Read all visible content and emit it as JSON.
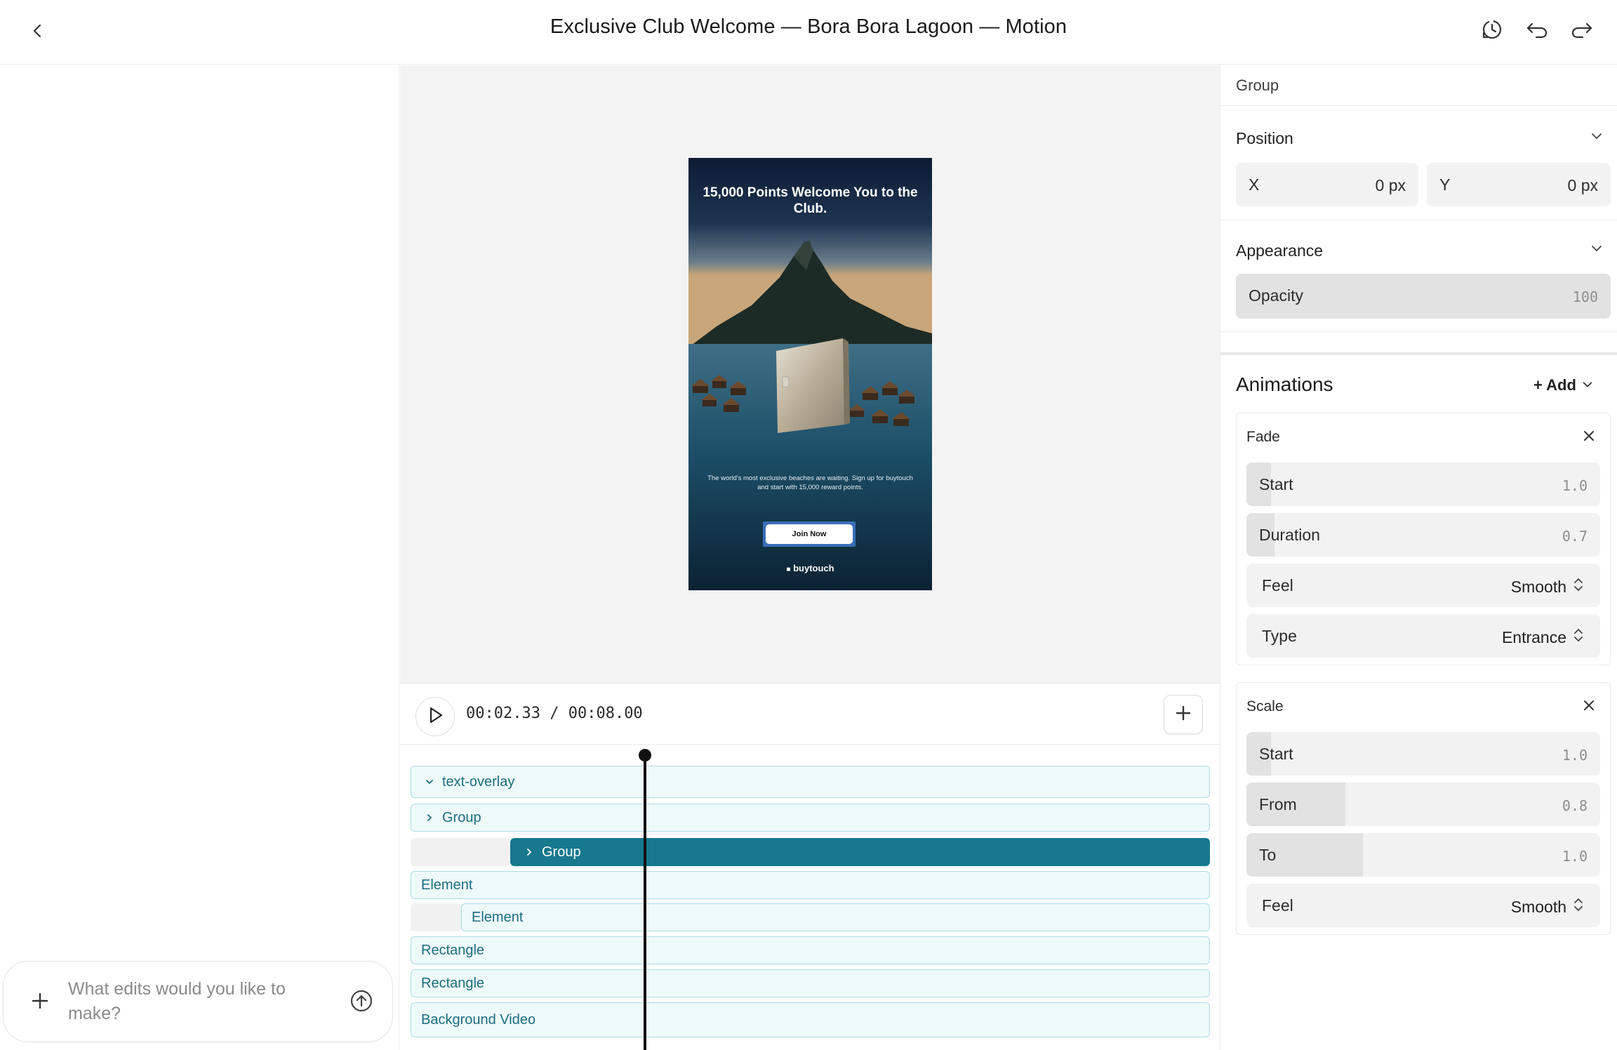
{
  "header": {
    "title": "Exclusive Club Welcome — Bora Bora Lagoon — Motion"
  },
  "chat": {
    "placeholder": "What edits would you like to make?"
  },
  "preview": {
    "headline": "15,000 Points Welcome You to the Club.",
    "subtext": "The world's most exclusive beaches are waiting. Sign up for buytouch and start with 15,000 reward points.",
    "cta_label": "Join Now",
    "brand": "buytouch",
    "cta_color": "#3a6fb8"
  },
  "transport": {
    "current_time": "00:02.33",
    "separator": " / ",
    "total_time": "00:08.00",
    "playhead_fraction": 0.291
  },
  "timeline": {
    "tracks": [
      {
        "label": "text-overlay",
        "expander": "expanded"
      },
      {
        "label": "Group",
        "expander": "collapsed"
      },
      {
        "label": "Group",
        "expander": "collapsed",
        "selected": true
      },
      {
        "label": "Element"
      },
      {
        "label": "Element"
      },
      {
        "label": "Rectangle"
      },
      {
        "label": "Rectangle"
      },
      {
        "label": "Background Video"
      }
    ],
    "selected_color": "#17788e"
  },
  "inspector": {
    "selection_label": "Group",
    "position": {
      "heading": "Position",
      "x_label": "X",
      "x_value": "0 px",
      "y_label": "Y",
      "y_value": "0 px"
    },
    "appearance": {
      "heading": "Appearance",
      "opacity_label": "Opacity",
      "opacity_value": "100"
    },
    "animations": {
      "heading": "Animations",
      "add_label": "+ Add",
      "fade": {
        "title": "Fade",
        "start_label": "Start",
        "start_value": "1.0",
        "duration_label": "Duration",
        "duration_value": "0.7",
        "feel_label": "Feel",
        "feel_value": "Smooth",
        "type_label": "Type",
        "type_value": "Entrance"
      },
      "scale": {
        "title": "Scale",
        "start_label": "Start",
        "start_value": "1.0",
        "from_label": "From",
        "from_value": "0.8",
        "to_label": "To",
        "to_value": "1.0",
        "feel_label": "Feel",
        "feel_value": "Smooth"
      }
    }
  },
  "icons": {
    "back": "chevron-left-icon",
    "history": "history-icon",
    "undo": "undo-icon",
    "redo": "redo-icon",
    "play": "play-icon",
    "add": "plus-icon",
    "send": "arrow-up-circle-icon"
  }
}
